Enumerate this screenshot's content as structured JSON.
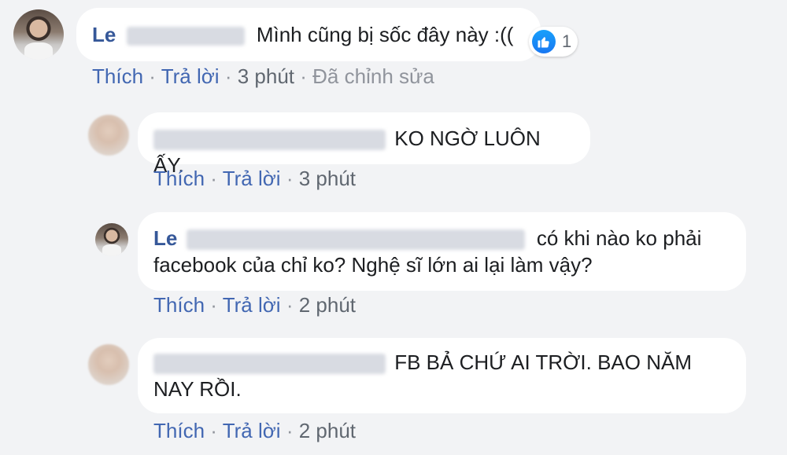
{
  "comments": [
    {
      "author_visible": "Le",
      "text": "Mình cũng bị sốc đây này :((",
      "like_label": "Thích",
      "reply_label": "Trả lời",
      "time": "3 phút",
      "edited": "Đã chỉnh sửa",
      "reaction_count": "1"
    },
    {
      "text": "KO NGỜ LUÔN ẤY.",
      "like_label": "Thích",
      "reply_label": "Trả lời",
      "time": "3 phút"
    },
    {
      "author_visible": "Le",
      "text_line1": "có khi nào ko phải",
      "text_line2": "facebook của chỉ ko? Nghệ sĩ lớn ai lại làm vậy?",
      "like_label": "Thích",
      "reply_label": "Trả lời",
      "time": "2 phút"
    },
    {
      "text_line1": "FB BẢ CHỨ AI TRỜI. BAO NĂM",
      "text_line2": "NAY RỒI.",
      "like_label": "Thích",
      "reply_label": "Trả lời",
      "time": "2 phút"
    }
  ],
  "separator": "·",
  "icons": {
    "reaction": "like-thumbs-up-icon"
  },
  "colors": {
    "link": "#4267b2",
    "author": "#365899",
    "like_blue": "#1877f2"
  }
}
